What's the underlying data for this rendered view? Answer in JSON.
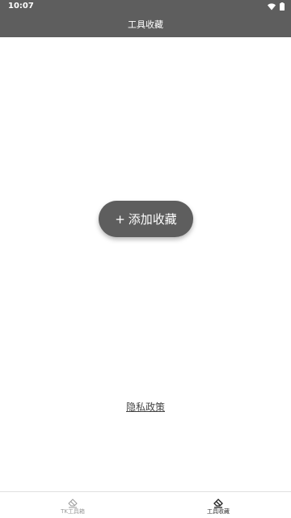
{
  "status_bar": {
    "time": "10:07",
    "icons": [
      "wifi-icon",
      "battery-icon"
    ]
  },
  "header": {
    "title": "工具收藏"
  },
  "main": {
    "add_button": {
      "plus": "+",
      "label": "添加收藏"
    },
    "privacy_link": "隐私政策"
  },
  "bottom_nav": {
    "items": [
      {
        "label": "TK工具箱",
        "icon": "eraser-icon",
        "active": false
      },
      {
        "label": "工具收藏",
        "icon": "eraser-icon",
        "active": true
      }
    ]
  },
  "colors": {
    "bar": "#5e5e5e",
    "background": "#ffffff",
    "inactive_text": "#9a9a9a",
    "active_text": "#333333"
  }
}
